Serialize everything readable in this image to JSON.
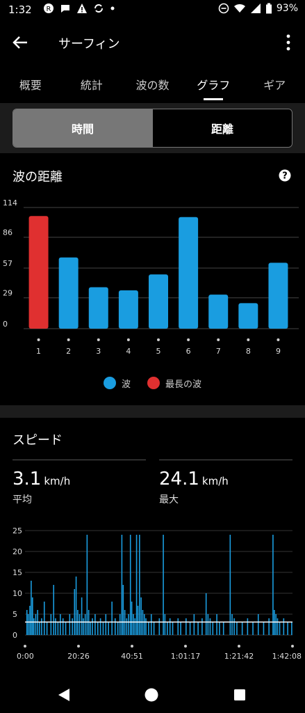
{
  "status_bar": {
    "time": "1:32",
    "battery": "93%"
  },
  "app_bar": {
    "title": "サーフィン"
  },
  "tabs": [
    {
      "label": "概要",
      "active": false
    },
    {
      "label": "統計",
      "active": false
    },
    {
      "label": "波の数",
      "active": false
    },
    {
      "label": "グラフ",
      "active": true
    },
    {
      "label": "ギア",
      "active": false
    }
  ],
  "toggle": {
    "time_label": "時間",
    "distance_label": "距離",
    "selected": "時間"
  },
  "wave_distance": {
    "title": "波の距離",
    "legend": {
      "wave": "波",
      "longest_wave": "最長の波"
    }
  },
  "speed": {
    "title": "スピード",
    "average": {
      "value": "3.1",
      "unit": "km/h",
      "label": "平均"
    },
    "max": {
      "value": "24.1",
      "unit": "km/h",
      "label": "最大"
    }
  },
  "chart_data": [
    {
      "type": "bar",
      "title": "波の距離",
      "categories": [
        "1",
        "2",
        "3",
        "4",
        "5",
        "6",
        "7",
        "8",
        "9"
      ],
      "series": [
        {
          "name": "波",
          "values": [
            106,
            67,
            39,
            36,
            51,
            105,
            32,
            24,
            62
          ]
        }
      ],
      "highlight_index": 0,
      "highlight_label": "最長の波",
      "y_ticks": [
        "0",
        "29",
        "57",
        "86",
        "114"
      ],
      "ylim": [
        0,
        114
      ],
      "colors": {
        "bar": "#1a9de0",
        "highlight": "#e03030",
        "grid": "#444444"
      },
      "grid": true,
      "legend_position": "bottom"
    },
    {
      "type": "bar",
      "title": "スピード",
      "x_ticks": [
        "0:00",
        "20:26",
        "40:51",
        "1:01:17",
        "1:21:42",
        "1:42:08"
      ],
      "y_ticks": [
        "0",
        "5",
        "10",
        "15",
        "20",
        "25"
      ],
      "ylim": [
        0,
        25
      ],
      "average_line": 3.1,
      "colors": {
        "bar": "#1a9de0",
        "average_line": "#ffffff",
        "grid": "#333333"
      },
      "grid": true,
      "samples": [
        {
          "t": 0.5,
          "v": 6
        },
        {
          "t": 1.0,
          "v": 5
        },
        {
          "t": 1.6,
          "v": 7
        },
        {
          "t": 2.1,
          "v": 13
        },
        {
          "t": 2.6,
          "v": 9
        },
        {
          "t": 3.1,
          "v": 4
        },
        {
          "t": 3.8,
          "v": 5
        },
        {
          "t": 4.5,
          "v": 6
        },
        {
          "t": 5.2,
          "v": 3
        },
        {
          "t": 6.0,
          "v": 4
        },
        {
          "t": 7.0,
          "v": 8
        },
        {
          "t": 8.0,
          "v": 3
        },
        {
          "t": 9.5,
          "v": 5
        },
        {
          "t": 10.5,
          "v": 12
        },
        {
          "t": 11.2,
          "v": 4
        },
        {
          "t": 12.1,
          "v": 3
        },
        {
          "t": 13.0,
          "v": 5
        },
        {
          "t": 14.0,
          "v": 4
        },
        {
          "t": 15.0,
          "v": 3
        },
        {
          "t": 16.5,
          "v": 5
        },
        {
          "t": 17.5,
          "v": 4
        },
        {
          "t": 18.3,
          "v": 11
        },
        {
          "t": 18.9,
          "v": 14
        },
        {
          "t": 19.5,
          "v": 6
        },
        {
          "t": 20.2,
          "v": 5
        },
        {
          "t": 21.0,
          "v": 9
        },
        {
          "t": 21.6,
          "v": 4
        },
        {
          "t": 22.3,
          "v": 5
        },
        {
          "t": 23.0,
          "v": 24
        },
        {
          "t": 23.6,
          "v": 6
        },
        {
          "t": 24.2,
          "v": 3
        },
        {
          "t": 25.0,
          "v": 4
        },
        {
          "t": 26.0,
          "v": 5
        },
        {
          "t": 27.0,
          "v": 3
        },
        {
          "t": 28.0,
          "v": 4
        },
        {
          "t": 29.0,
          "v": 3
        },
        {
          "t": 30.0,
          "v": 5
        },
        {
          "t": 31.0,
          "v": 3
        },
        {
          "t": 32.3,
          "v": 8
        },
        {
          "t": 33.5,
          "v": 4
        },
        {
          "t": 34.5,
          "v": 3
        },
        {
          "t": 35.3,
          "v": 5
        },
        {
          "t": 36.0,
          "v": 24
        },
        {
          "t": 36.5,
          "v": 12
        },
        {
          "t": 37.1,
          "v": 6
        },
        {
          "t": 37.8,
          "v": 4
        },
        {
          "t": 38.5,
          "v": 5
        },
        {
          "t": 39.2,
          "v": 24
        },
        {
          "t": 39.7,
          "v": 8
        },
        {
          "t": 40.3,
          "v": 5
        },
        {
          "t": 40.9,
          "v": 4
        },
        {
          "t": 41.5,
          "v": 24
        },
        {
          "t": 42.0,
          "v": 7
        },
        {
          "t": 42.6,
          "v": 24
        },
        {
          "t": 43.2,
          "v": 9
        },
        {
          "t": 43.8,
          "v": 6
        },
        {
          "t": 44.4,
          "v": 5
        },
        {
          "t": 45.0,
          "v": 4
        },
        {
          "t": 46.0,
          "v": 3
        },
        {
          "t": 47.0,
          "v": 5
        },
        {
          "t": 48.0,
          "v": 3
        },
        {
          "t": 50.0,
          "v": 4
        },
        {
          "t": 51.5,
          "v": 24
        },
        {
          "t": 52.1,
          "v": 5
        },
        {
          "t": 53.0,
          "v": 3
        },
        {
          "t": 54.0,
          "v": 4
        },
        {
          "t": 55.0,
          "v": 3
        },
        {
          "t": 57.0,
          "v": 4
        },
        {
          "t": 58.0,
          "v": 3
        },
        {
          "t": 60.0,
          "v": 4
        },
        {
          "t": 61.5,
          "v": 3
        },
        {
          "t": 63.0,
          "v": 5
        },
        {
          "t": 64.5,
          "v": 3
        },
        {
          "t": 66.0,
          "v": 4
        },
        {
          "t": 67.5,
          "v": 10
        },
        {
          "t": 68.2,
          "v": 5
        },
        {
          "t": 69.0,
          "v": 4
        },
        {
          "t": 70.0,
          "v": 3
        },
        {
          "t": 71.5,
          "v": 5
        },
        {
          "t": 72.5,
          "v": 3
        },
        {
          "t": 74.0,
          "v": 3
        },
        {
          "t": 76.5,
          "v": 24
        },
        {
          "t": 77.2,
          "v": 5
        },
        {
          "t": 78.0,
          "v": 4
        },
        {
          "t": 79.0,
          "v": 3
        },
        {
          "t": 81.0,
          "v": 3
        },
        {
          "t": 83.0,
          "v": 4
        },
        {
          "t": 85.0,
          "v": 3
        },
        {
          "t": 87.0,
          "v": 5
        },
        {
          "t": 89.0,
          "v": 3
        },
        {
          "t": 91.0,
          "v": 4
        },
        {
          "t": 92.5,
          "v": 24
        },
        {
          "t": 93.0,
          "v": 6
        },
        {
          "t": 93.6,
          "v": 5
        },
        {
          "t": 94.2,
          "v": 4
        },
        {
          "t": 95.0,
          "v": 3
        },
        {
          "t": 96.5,
          "v": 4
        },
        {
          "t": 98.0,
          "v": 3
        },
        {
          "t": 99.5,
          "v": 3
        }
      ]
    }
  ]
}
